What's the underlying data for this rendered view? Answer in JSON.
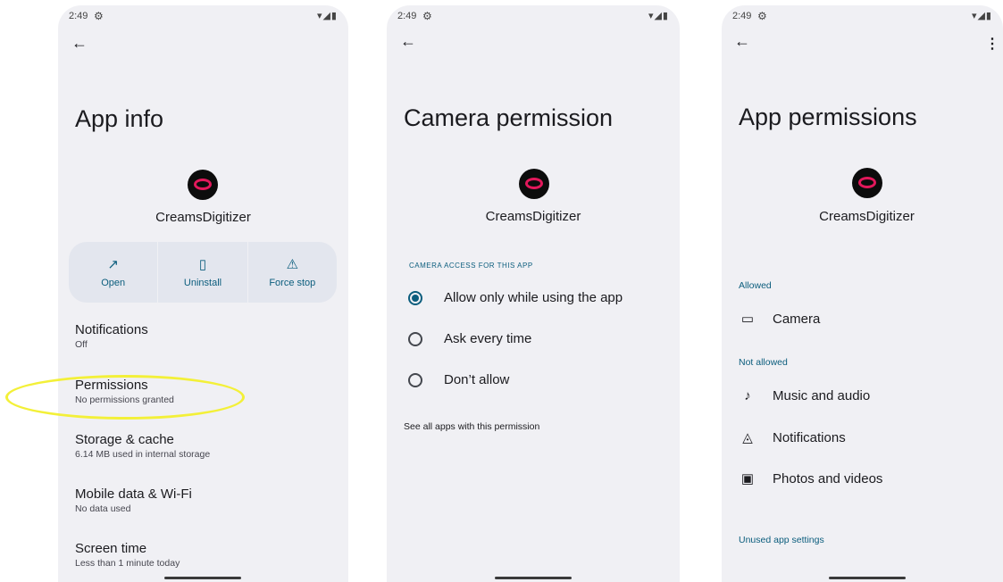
{
  "status_bar": {
    "time": "2:49",
    "settings_glyph": "⚙",
    "system_icons": "▾◢▮"
  },
  "screen1": {
    "title": "App info",
    "app_name": "CreamsDigitizer",
    "actions": [
      {
        "label": "Open",
        "icon": "open-external-icon",
        "glyph": "↗"
      },
      {
        "label": "Uninstall",
        "icon": "trash-icon",
        "glyph": "🗑"
      },
      {
        "label": "Force stop",
        "icon": "warning-icon",
        "glyph": "⚠"
      }
    ],
    "prefs": [
      {
        "title": "Notifications",
        "summary": "Off"
      },
      {
        "title": "Permissions",
        "summary": "No permissions granted"
      },
      {
        "title": "Storage & cache",
        "summary": "6.14 MB used in internal storage"
      },
      {
        "title": "Mobile data & Wi-Fi",
        "summary": "No data used"
      },
      {
        "title": "Screen time",
        "summary": "Less than 1 minute today"
      }
    ],
    "highlight_color": "#f3f038"
  },
  "screen2": {
    "title": "Camera permission",
    "app_name": "CreamsDigitizer",
    "section": "CAMERA ACCESS FOR THIS APP",
    "options": [
      {
        "label": "Allow only while using the app",
        "selected": true
      },
      {
        "label": "Ask every time",
        "selected": false
      },
      {
        "label": "Don’t allow",
        "selected": false
      }
    ],
    "link": "See all apps with this permission"
  },
  "screen3": {
    "title": "App permissions",
    "app_name": "CreamsDigitizer",
    "allowed_header": "Allowed",
    "allowed": [
      {
        "label": "Camera",
        "icon": "camera-icon",
        "glyph": "▭◂"
      }
    ],
    "not_allowed_header": "Not allowed",
    "not_allowed": [
      {
        "label": "Music and audio",
        "icon": "music-note-icon",
        "glyph": "♪"
      },
      {
        "label": "Notifications",
        "icon": "bell-icon",
        "glyph": "🔔"
      },
      {
        "label": "Photos and videos",
        "icon": "photo-library-icon",
        "glyph": "▣"
      }
    ],
    "unused_header": "Unused app settings",
    "more_glyph": "⋮"
  },
  "colors": {
    "accent": "#0b5d7d",
    "surface": "#f0f0f4",
    "card": "#e3e6ee"
  }
}
